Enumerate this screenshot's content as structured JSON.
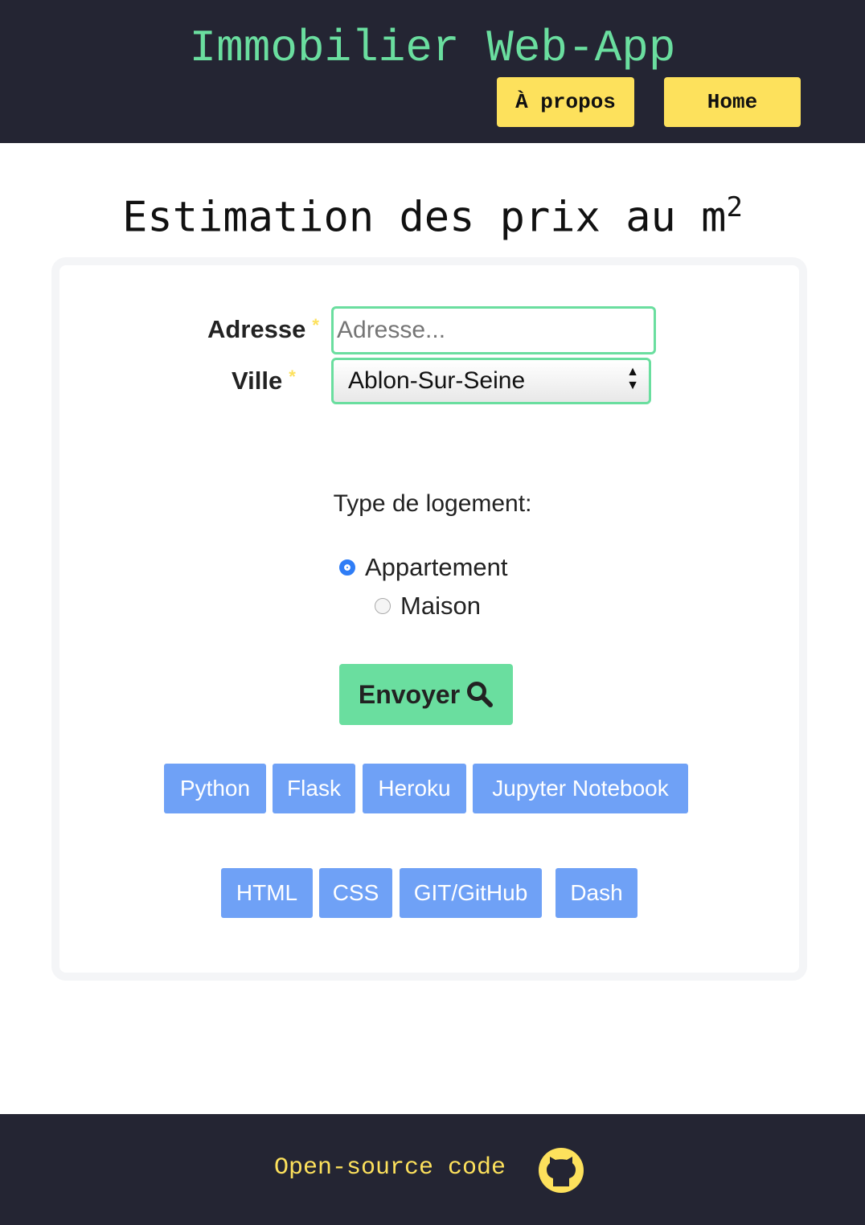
{
  "header": {
    "title": "Immobilier Web-App",
    "nav": [
      "À propos",
      "Home"
    ]
  },
  "page_title": "Estimation des prix au m",
  "page_title_sup": "2",
  "form": {
    "address_label": "Adresse",
    "address_placeholder": "Adresse...",
    "required": "*",
    "city_label": "Ville",
    "city_value": "Ablon-Sur-Seine",
    "type_label": "Type de logement:",
    "options": [
      "Appartement",
      "Maison"
    ],
    "selected": "Appartement",
    "submit": "Envoyer"
  },
  "tags": [
    "Python",
    "Flask",
    "Heroku",
    "Jupyter Notebook",
    "HTML",
    "CSS",
    "GIT/GitHub",
    "Dash"
  ],
  "footer": {
    "text": "Open-source code"
  }
}
